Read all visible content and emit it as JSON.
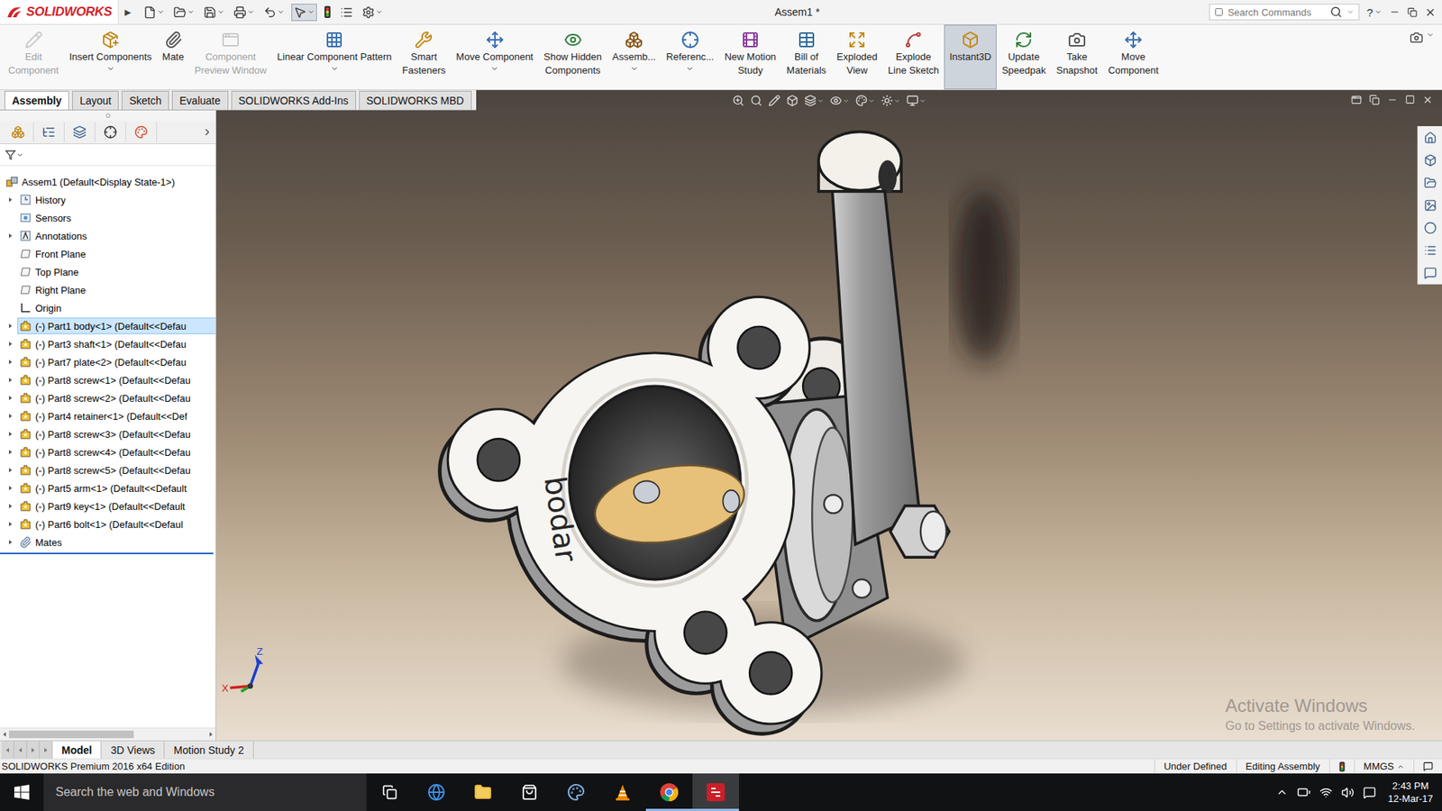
{
  "app": {
    "logo": "SOLIDWORKS",
    "menu_toggle": "▶",
    "title": "Assem1 *",
    "search_placeholder": "Search Commands",
    "help": "?"
  },
  "ribbon": [
    {
      "lines": [
        "Edit",
        "Component"
      ],
      "disabled": true,
      "selected": false,
      "dropdown": false
    },
    {
      "lines": [
        "Insert Components"
      ],
      "disabled": false,
      "selected": false,
      "dropdown": true
    },
    {
      "lines": [
        "Mate"
      ],
      "disabled": false,
      "selected": false,
      "dropdown": false
    },
    {
      "lines": [
        "Component",
        "Preview Window"
      ],
      "disabled": true,
      "selected": false,
      "dropdown": false
    },
    {
      "lines": [
        "Linear Component Pattern"
      ],
      "disabled": false,
      "selected": false,
      "dropdown": true
    },
    {
      "lines": [
        "Smart",
        "Fasteners"
      ],
      "disabled": false,
      "selected": false,
      "dropdown": false
    },
    {
      "lines": [
        "Move Component"
      ],
      "disabled": false,
      "selected": false,
      "dropdown": true
    },
    {
      "lines": [
        "Show Hidden",
        "Components"
      ],
      "disabled": false,
      "selected": false,
      "dropdown": false
    },
    {
      "lines": [
        "Assemb..."
      ],
      "disabled": false,
      "selected": false,
      "dropdown": true
    },
    {
      "lines": [
        "Referenc..."
      ],
      "disabled": false,
      "selected": false,
      "dropdown": true
    },
    {
      "lines": [
        "New Motion",
        "Study"
      ],
      "disabled": false,
      "selected": false,
      "dropdown": false
    },
    {
      "lines": [
        "Bill of",
        "Materials"
      ],
      "disabled": false,
      "selected": false,
      "dropdown": false
    },
    {
      "lines": [
        "Exploded",
        "View"
      ],
      "disabled": false,
      "selected": false,
      "dropdown": false
    },
    {
      "lines": [
        "Explode",
        "Line Sketch"
      ],
      "disabled": false,
      "selected": false,
      "dropdown": false
    },
    {
      "lines": [
        "Instant3D"
      ],
      "disabled": false,
      "selected": true,
      "dropdown": false
    },
    {
      "lines": [
        "Update",
        "Speedpak"
      ],
      "disabled": false,
      "selected": false,
      "dropdown": false
    },
    {
      "lines": [
        "Take",
        "Snapshot"
      ],
      "disabled": false,
      "selected": false,
      "dropdown": false
    },
    {
      "lines": [
        "Move",
        "Component"
      ],
      "disabled": false,
      "selected": false,
      "dropdown": false
    }
  ],
  "tabs": [
    {
      "label": "Assembly",
      "selected": true
    },
    {
      "label": "Layout",
      "selected": false
    },
    {
      "label": "Sketch",
      "selected": false
    },
    {
      "label": "Evaluate",
      "selected": false
    },
    {
      "label": "SOLIDWORKS Add-Ins",
      "selected": false
    },
    {
      "label": "SOLIDWORKS MBD",
      "selected": false
    }
  ],
  "tree": {
    "items": [
      {
        "label": "Assem1  (Default<Display State-1>)",
        "kind": "root",
        "expandable": false,
        "selected": false
      },
      {
        "label": "History",
        "kind": "history",
        "expandable": true,
        "selected": false
      },
      {
        "label": "Sensors",
        "kind": "sensors",
        "expandable": false,
        "selected": false
      },
      {
        "label": "Annotations",
        "kind": "annotations",
        "expandable": true,
        "selected": false
      },
      {
        "label": "Front Plane",
        "kind": "plane",
        "expandable": false,
        "selected": false
      },
      {
        "label": "Top Plane",
        "kind": "plane",
        "expandable": false,
        "selected": false
      },
      {
        "label": "Right Plane",
        "kind": "plane",
        "expandable": false,
        "selected": false
      },
      {
        "label": "Origin",
        "kind": "origin",
        "expandable": false,
        "selected": false
      },
      {
        "label": "(-) Part1 body<1> (Default<<Defau",
        "kind": "part",
        "expandable": true,
        "selected": true
      },
      {
        "label": "(-) Part3 shaft<1> (Default<<Defau",
        "kind": "part",
        "expandable": true,
        "selected": false
      },
      {
        "label": "(-) Part7 plate<2> (Default<<Defau",
        "kind": "part",
        "expandable": true,
        "selected": false
      },
      {
        "label": "(-) Part8 screw<1> (Default<<Defau",
        "kind": "part",
        "expandable": true,
        "selected": false
      },
      {
        "label": "(-) Part8 screw<2> (Default<<Defau",
        "kind": "part",
        "expandable": true,
        "selected": false
      },
      {
        "label": "(-) Part4 retainer<1> (Default<<Def",
        "kind": "part",
        "expandable": true,
        "selected": false
      },
      {
        "label": "(-) Part8 screw<3> (Default<<Defau",
        "kind": "part",
        "expandable": true,
        "selected": false
      },
      {
        "label": "(-) Part8 screw<4> (Default<<Defau",
        "kind": "part",
        "expandable": true,
        "selected": false
      },
      {
        "label": "(-) Part8 screw<5> (Default<<Defau",
        "kind": "part",
        "expandable": true,
        "selected": false
      },
      {
        "label": "(-) Part5 arm<1> (Default<<Default",
        "kind": "part",
        "expandable": true,
        "selected": false
      },
      {
        "label": "(-) Part9 key<1> (Default<<Default",
        "kind": "part",
        "expandable": true,
        "selected": false
      },
      {
        "label": "(-) Part6 bolt<1> (Default<<Defaul",
        "kind": "part",
        "expandable": true,
        "selected": false
      },
      {
        "label": "Mates",
        "kind": "mates",
        "expandable": true,
        "selected": false
      }
    ]
  },
  "viewport": {
    "model_label": "bodar",
    "axes": [
      "Z",
      "X"
    ]
  },
  "bottom_tabs": [
    {
      "label": "Model",
      "selected": true
    },
    {
      "label": "3D Views",
      "selected": false
    },
    {
      "label": "Motion Study 2",
      "selected": false
    }
  ],
  "status_bar": {
    "edition": "SOLIDWORKS Premium 2016 x64 Edition",
    "state": "Under Defined",
    "mode": "Editing Assembly",
    "units": "MMGS"
  },
  "watermark": {
    "title": "Activate Windows",
    "subtitle": "Go to Settings to activate Windows."
  },
  "taskbar": {
    "search": "Search the web and Windows",
    "time": "2:43 PM",
    "date": "12-Mar-17",
    "apps": [
      {
        "kind": "task-view",
        "running": false,
        "selected": false
      },
      {
        "kind": "edge",
        "running": false,
        "selected": false
      },
      {
        "kind": "explorer",
        "running": false,
        "selected": false
      },
      {
        "kind": "store",
        "running": false,
        "selected": false
      },
      {
        "kind": "paint",
        "running": false,
        "selected": false
      },
      {
        "kind": "vlc",
        "running": false,
        "selected": false
      },
      {
        "kind": "chrome",
        "running": true,
        "selected": false
      },
      {
        "kind": "solidworks",
        "running": true,
        "selected": true
      }
    ]
  }
}
